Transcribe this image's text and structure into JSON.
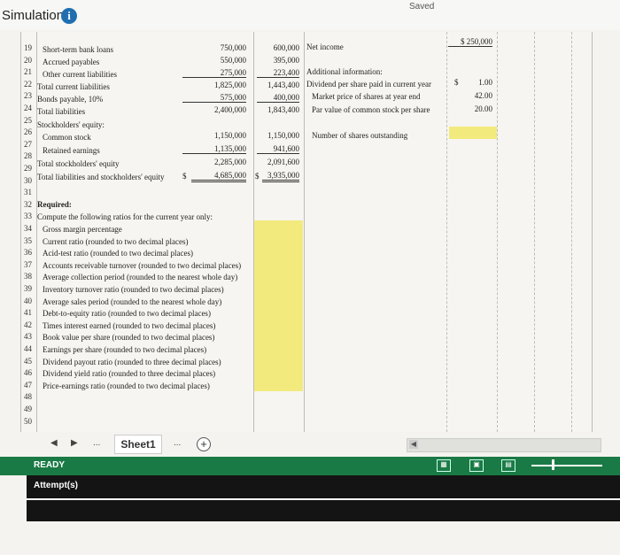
{
  "header": {
    "title": "Simulation",
    "info": "i",
    "saved": "Saved"
  },
  "rows": [
    "19",
    "20",
    "21",
    "22",
    "23",
    "24",
    "25",
    "26",
    "27",
    "28",
    "29",
    "30",
    "31",
    "32",
    "33",
    "34",
    "35",
    "36",
    "37",
    "38",
    "39",
    "40",
    "41",
    "42",
    "43",
    "44",
    "45",
    "46",
    "47",
    "48",
    "49",
    "50"
  ],
  "balance": {
    "short_term_loans": {
      "label": "Short-term bank loans",
      "cur": "750,000",
      "prior": "600,000"
    },
    "accrued": {
      "label": "Accrued payables",
      "cur": "550,000",
      "prior": "395,000"
    },
    "other_current": {
      "label": "Other current liabilities",
      "cur": "275,000",
      "prior": "223,400"
    },
    "total_current": {
      "label": "Total current liabilities",
      "cur": "1,825,000",
      "prior": "1,443,400"
    },
    "bonds": {
      "label": "Bonds payable, 10%",
      "cur": "575,000",
      "prior": "400,000"
    },
    "total_liab": {
      "label": "Total liabilities",
      "cur": "2,400,000",
      "prior": "1,843,400"
    },
    "equity_header": "Stockholders' equity:",
    "common": {
      "label": "Common stock",
      "cur": "1,150,000",
      "prior": "1,150,000"
    },
    "retained": {
      "label": "Retained earnings",
      "cur": "1,135,000",
      "prior": "941,600"
    },
    "total_equity": {
      "label": "Total stockholders' equity",
      "cur": "2,285,000",
      "prior": "2,091,600"
    },
    "total_le": {
      "label": "Total liabilities and stockholders' equity",
      "dollar": "$",
      "cur": "4,685,000",
      "prior_dollar": "$",
      "prior": "3,935,000"
    }
  },
  "right_panel": {
    "net_income": {
      "label": "Net income",
      "value": "$ 250,000"
    },
    "additional": "Additional information:",
    "dividend": {
      "label": "Dividend per share paid in current year",
      "dollar": "$",
      "value": "1.00"
    },
    "market_price": {
      "label": "Market price of shares at year end",
      "value": "42.00"
    },
    "par_value": {
      "label": "Par value of common stock per share",
      "value": "20.00"
    },
    "shares": {
      "label": "Number of shares outstanding"
    }
  },
  "required": {
    "header": "Required:",
    "instruction": "Compute the following ratios for the current year only:",
    "items": [
      "Gross margin percentage",
      "Current ratio (rounded to two decimal places)",
      "Acid-test ratio (rounded to two decimal places)",
      "Accounts receivable turnover (rounded to two decimal places)",
      "Average collection period (rounded to the nearest whole day)",
      "Inventory turnover ratio (rounded to two decimal places)",
      "Average sales period (rounded to the nearest whole day)",
      "Debt-to-equity ratio (rounded to two decimal places)",
      "Times interest earned (rounded to two decimal places)",
      "Book value per share (rounded to two decimal places)",
      "Earnings per share (rounded to two decimal places)",
      "Dividend payout ratio (rounded to three decimal places)",
      "Dividend yield ratio (rounded to three decimal places)",
      "Price-earnings ratio (rounded to two decimal places)"
    ]
  },
  "tabs": {
    "prev": "◀",
    "next": "▶",
    "more_left": "...",
    "sheet": "Sheet1",
    "more_right": "...",
    "add": "+"
  },
  "status": {
    "ready": "READY"
  },
  "attempts": {
    "label": "Attempt(s)"
  },
  "colors": {
    "answer_fill": "#f3ea7e",
    "status_bar": "#1a7a45",
    "info_icon": "#1f6fb0"
  }
}
